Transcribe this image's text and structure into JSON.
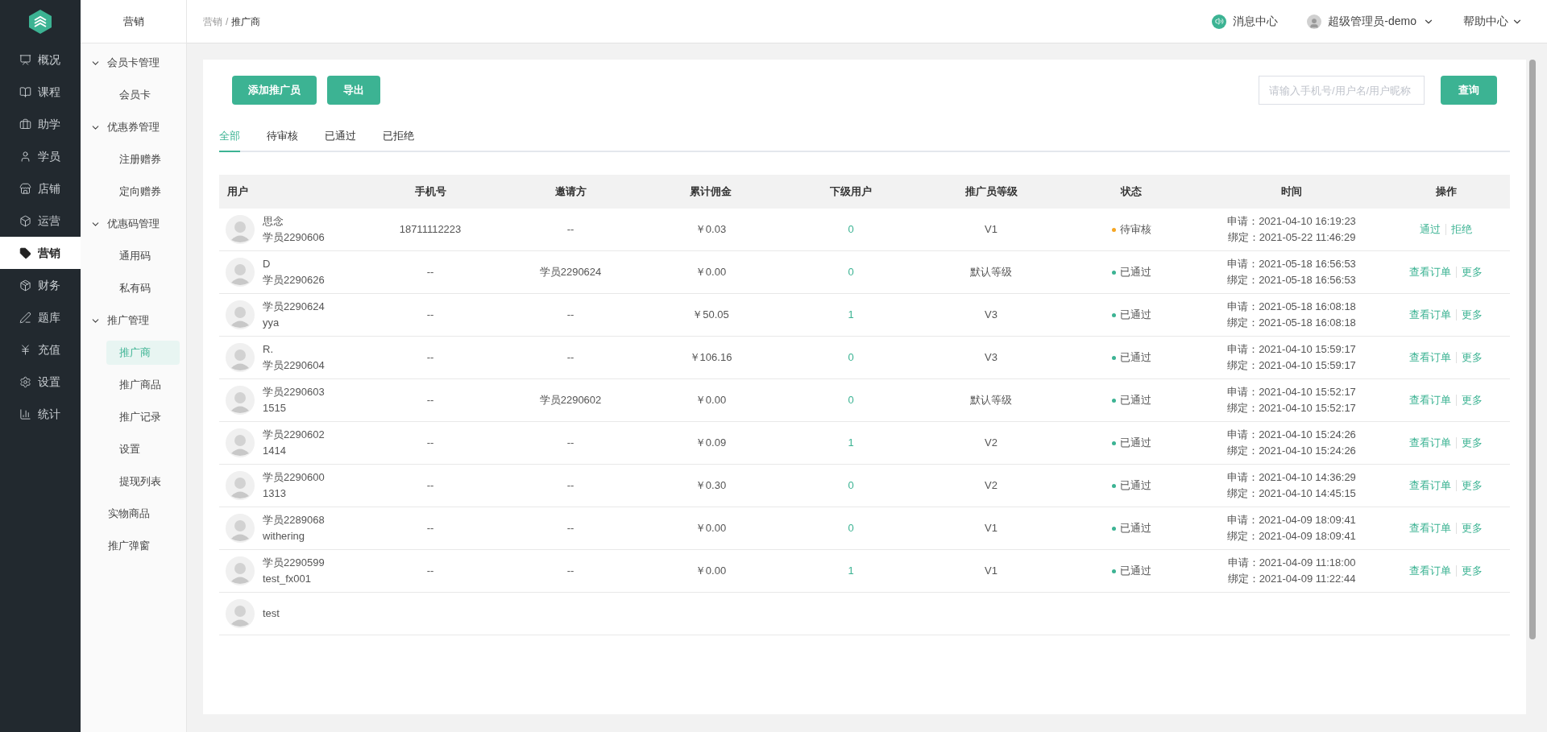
{
  "nav_rail": {
    "items": [
      {
        "label": "概况",
        "selected": false
      },
      {
        "label": "课程",
        "selected": false
      },
      {
        "label": "助学",
        "selected": false
      },
      {
        "label": "学员",
        "selected": false
      },
      {
        "label": "店铺",
        "selected": false
      },
      {
        "label": "运营",
        "selected": false
      },
      {
        "label": "营销",
        "selected": true
      },
      {
        "label": "财务",
        "selected": false
      },
      {
        "label": "题库",
        "selected": false
      },
      {
        "label": "充值",
        "selected": false
      },
      {
        "label": "设置",
        "selected": false
      },
      {
        "label": "统计",
        "selected": false
      }
    ]
  },
  "submenu": {
    "title": "营销",
    "items": [
      {
        "label": "会员卡管理",
        "expanded": true,
        "children": [
          {
            "label": "会员卡",
            "selected": false
          }
        ]
      },
      {
        "label": "优惠券管理",
        "expanded": true,
        "children": [
          {
            "label": "注册赠券",
            "selected": false
          },
          {
            "label": "定向赠券",
            "selected": false
          }
        ]
      },
      {
        "label": "优惠码管理",
        "expanded": true,
        "children": [
          {
            "label": "通用码",
            "selected": false
          },
          {
            "label": "私有码",
            "selected": false
          }
        ]
      },
      {
        "label": "推广管理",
        "expanded": true,
        "children": [
          {
            "label": "推广商",
            "selected": true
          },
          {
            "label": "推广商品",
            "selected": false
          },
          {
            "label": "推广记录",
            "selected": false
          },
          {
            "label": "设置",
            "selected": false
          },
          {
            "label": "提现列表",
            "selected": false
          }
        ]
      },
      {
        "label": "实物商品",
        "selected": false
      },
      {
        "label": "推广弹窗",
        "selected": false
      }
    ]
  },
  "header": {
    "breadcrumb": [
      "营销",
      "推广商"
    ],
    "separator": "/",
    "notifications": "消息中心",
    "user": "超级管理员-demo",
    "help": "帮助中心"
  },
  "toolbar": {
    "buttons": [
      "添加推广员",
      "导出"
    ],
    "search": {
      "placeholder": "请输入手机号/用户名/用户昵称"
    },
    "query_button": "查询"
  },
  "tabs": [
    {
      "label": "全部",
      "selected": true
    },
    {
      "label": "待审核",
      "selected": false
    },
    {
      "label": "已通过",
      "selected": false
    },
    {
      "label": "已拒绝",
      "selected": false
    }
  ],
  "table": {
    "columns": [
      "用户",
      "手机号",
      "邀请方",
      "累计佣金",
      "下级用户",
      "推广员等级",
      "状态",
      "时间",
      "操作"
    ],
    "rows": [
      {
        "user": [
          "思念",
          "学员2290606"
        ],
        "phone": "18711112223",
        "inviter": "--",
        "commission": "￥0.03",
        "sub_users": "0",
        "level": "V1",
        "status": {
          "label": "待审核",
          "color": "#f5a623"
        },
        "times": [
          "申请：2021-04-10 16:19:23",
          "绑定：2021-05-22 11:46:29"
        ],
        "actions": [
          "通过",
          "拒绝"
        ]
      },
      {
        "user": [
          "D",
          "学员2290626"
        ],
        "phone": "--",
        "inviter": "学员2290624",
        "commission": "￥0.00",
        "sub_users": "0",
        "level": "默认等级",
        "status": {
          "label": "已通过",
          "color": "#3cb393"
        },
        "times": [
          "申请：2021-05-18 16:56:53",
          "绑定：2021-05-18 16:56:53"
        ],
        "actions": [
          "查看订单",
          "更多"
        ]
      },
      {
        "user": [
          "学员2290624",
          "yya"
        ],
        "phone": "--",
        "inviter": "--",
        "commission": "￥50.05",
        "sub_users": "1",
        "level": "V3",
        "status": {
          "label": "已通过",
          "color": "#3cb393"
        },
        "times": [
          "申请：2021-05-18 16:08:18",
          "绑定：2021-05-18 16:08:18"
        ],
        "actions": [
          "查看订单",
          "更多"
        ]
      },
      {
        "user": [
          "R.",
          "学员2290604"
        ],
        "phone": "--",
        "inviter": "--",
        "commission": "￥106.16",
        "sub_users": "0",
        "level": "V3",
        "status": {
          "label": "已通过",
          "color": "#3cb393"
        },
        "times": [
          "申请：2021-04-10 15:59:17",
          "绑定：2021-04-10 15:59:17"
        ],
        "actions": [
          "查看订单",
          "更多"
        ]
      },
      {
        "user": [
          "学员2290603",
          "1515"
        ],
        "phone": "--",
        "inviter": "学员2290602",
        "commission": "￥0.00",
        "sub_users": "0",
        "level": "默认等级",
        "status": {
          "label": "已通过",
          "color": "#3cb393"
        },
        "times": [
          "申请：2021-04-10 15:52:17",
          "绑定：2021-04-10 15:52:17"
        ],
        "actions": [
          "查看订单",
          "更多"
        ]
      },
      {
        "user": [
          "学员2290602",
          "1414"
        ],
        "phone": "--",
        "inviter": "--",
        "commission": "￥0.09",
        "sub_users": "1",
        "level": "V2",
        "status": {
          "label": "已通过",
          "color": "#3cb393"
        },
        "times": [
          "申请：2021-04-10 15:24:26",
          "绑定：2021-04-10 15:24:26"
        ],
        "actions": [
          "查看订单",
          "更多"
        ]
      },
      {
        "user": [
          "学员2290600",
          "1313"
        ],
        "phone": "--",
        "inviter": "--",
        "commission": "￥0.30",
        "sub_users": "0",
        "level": "V2",
        "status": {
          "label": "已通过",
          "color": "#3cb393"
        },
        "times": [
          "申请：2021-04-10 14:36:29",
          "绑定：2021-04-10 14:45:15"
        ],
        "actions": [
          "查看订单",
          "更多"
        ]
      },
      {
        "user": [
          "学员2289068",
          "withering"
        ],
        "phone": "--",
        "inviter": "--",
        "commission": "￥0.00",
        "sub_users": "0",
        "level": "V1",
        "status": {
          "label": "已通过",
          "color": "#3cb393"
        },
        "times": [
          "申请：2021-04-09 18:09:41",
          "绑定：2021-04-09 18:09:41"
        ],
        "actions": [
          "查看订单",
          "更多"
        ]
      },
      {
        "user": [
          "学员2290599",
          "test_fx001"
        ],
        "phone": "--",
        "inviter": "--",
        "commission": "￥0.00",
        "sub_users": "1",
        "level": "V1",
        "status": {
          "label": "已通过",
          "color": "#3cb393"
        },
        "times": [
          "申请：2021-04-09 11:18:00",
          "绑定：2021-04-09 11:22:44"
        ],
        "actions": [
          "查看订单",
          "更多"
        ]
      },
      {
        "user": [
          "test"
        ]
      }
    ]
  }
}
